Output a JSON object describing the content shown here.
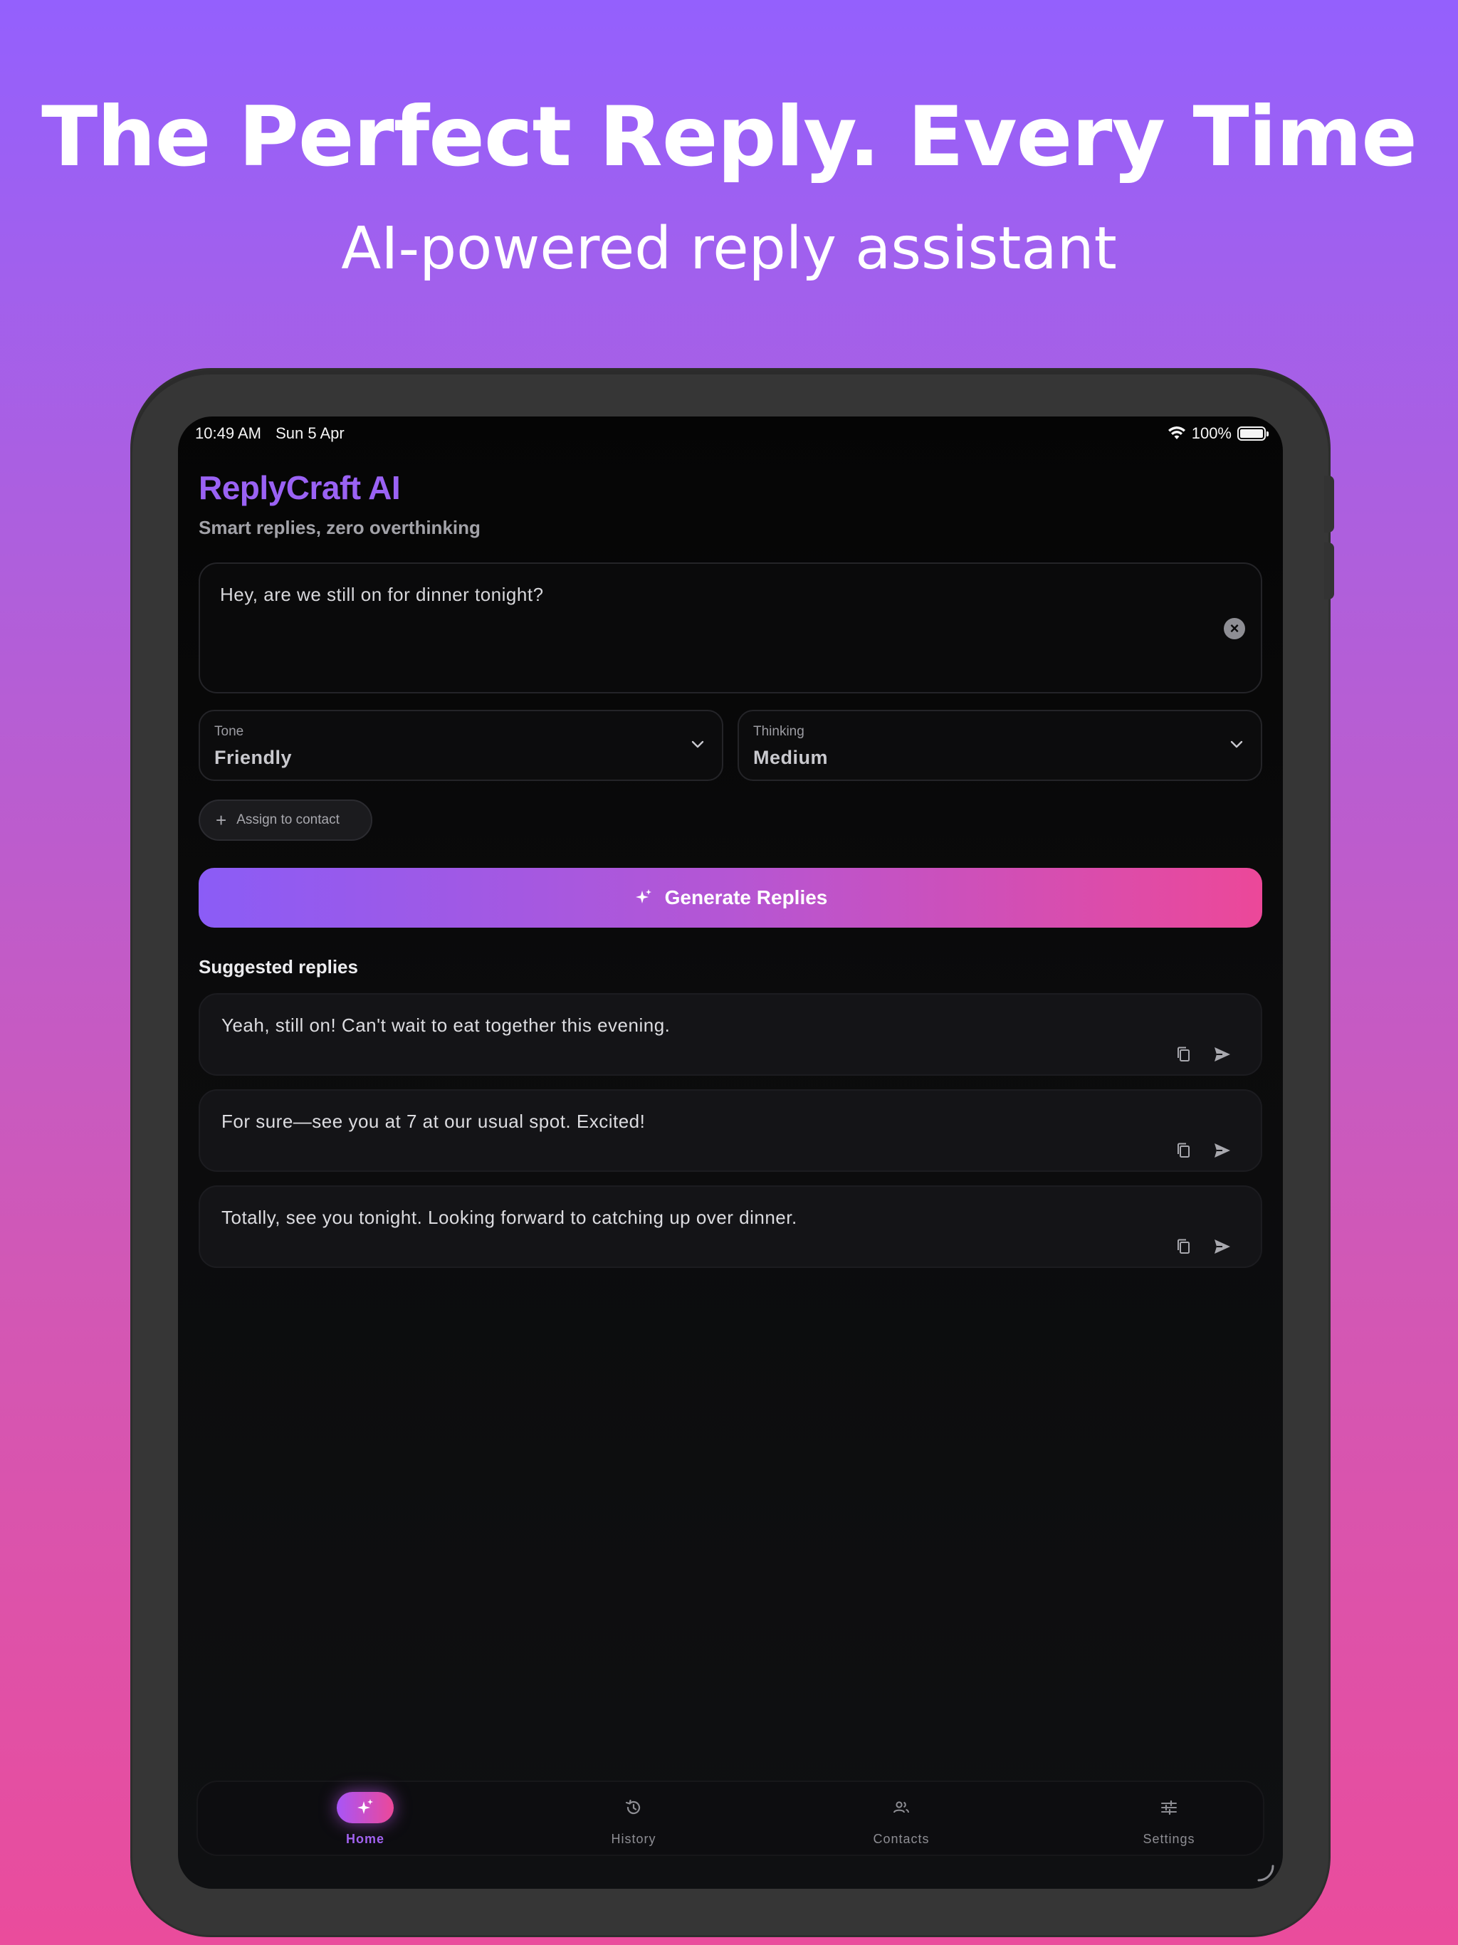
{
  "banner": {
    "headline": "The Perfect Reply. Every Time",
    "subheadline": "AI-powered reply assistant"
  },
  "status_bar": {
    "time": "10:49 AM",
    "date": "Sun 5 Apr",
    "battery": "100%"
  },
  "app": {
    "title": "ReplyCraft AI",
    "subtitle": "Smart replies, zero overthinking"
  },
  "message": {
    "value": "Hey, are we still on for dinner tonight?"
  },
  "tone": {
    "label": "Tone",
    "value": "Friendly"
  },
  "thinking": {
    "label": "Thinking",
    "value": "Medium"
  },
  "assign": {
    "label": "Assign to contact"
  },
  "generate": {
    "label": "Generate Replies"
  },
  "suggestions": {
    "title": "Suggested replies",
    "items": [
      {
        "text": "Yeah, still on! Can't wait to eat together this evening."
      },
      {
        "text": "For sure—see you at 7 at our usual spot. Excited!"
      },
      {
        "text": "Totally, see you tonight. Looking forward to catching up over dinner."
      }
    ]
  },
  "nav": {
    "items": [
      {
        "label": "Home",
        "icon": "sparkles-icon",
        "active": true
      },
      {
        "label": "History",
        "icon": "history-icon",
        "active": false
      },
      {
        "label": "Contacts",
        "icon": "contacts-icon",
        "active": false
      },
      {
        "label": "Settings",
        "icon": "sliders-icon",
        "active": false
      }
    ]
  },
  "colors": {
    "accent": "#9a62f4",
    "gradient_start": "#8b5cf6",
    "gradient_end": "#ec4899"
  }
}
